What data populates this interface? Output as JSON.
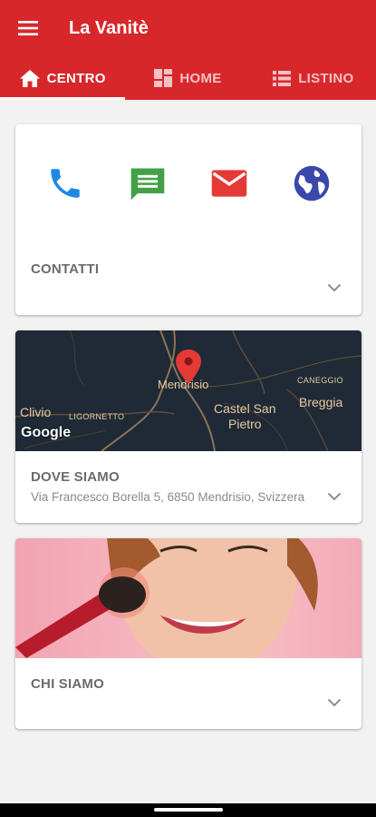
{
  "app": {
    "title": "La Vanitè"
  },
  "colors": {
    "primary": "#d8272b",
    "phone": "#1e88e5",
    "sms": "#43a047",
    "mail": "#e53935",
    "web": "#3949ab"
  },
  "tabs": [
    {
      "label": "CENTRO",
      "icon": "home-icon",
      "active": true
    },
    {
      "label": "HOME",
      "icon": "dashboard-icon",
      "active": false
    },
    {
      "label": "LISTINO",
      "icon": "list-icon",
      "active": false
    }
  ],
  "contact_card": {
    "title": "CONTATTI",
    "actions": [
      {
        "icon": "phone-icon"
      },
      {
        "icon": "message-icon"
      },
      {
        "icon": "mail-icon"
      },
      {
        "icon": "globe-icon"
      }
    ]
  },
  "map_card": {
    "title": "DOVE SIAMO",
    "address": "Via Francesco Borella 5, 6850 Mendrisio, Svizzera",
    "map_labels": {
      "mendrisio": "Mendrisio",
      "castel": "Castel San",
      "pietro": "Pietro",
      "breggia": "Breggia",
      "caneggio": "CANEGGIO",
      "clivio": "Clivio",
      "ligornetto": "LIGORNETTO"
    },
    "map_attribution": "Google"
  },
  "about_card": {
    "title": "CHI SIAMO"
  }
}
